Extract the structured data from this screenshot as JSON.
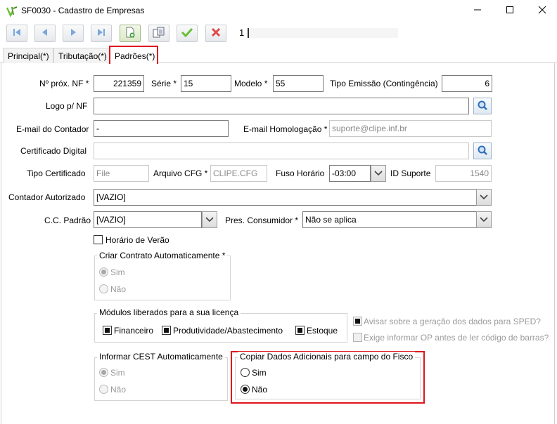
{
  "window": {
    "title": "SF0030 - Cadastro de Empresas",
    "minimize_icon": "minimize-icon",
    "maximize_icon": "maximize-icon",
    "close_icon": "close-icon"
  },
  "toolbar": {
    "buttons": [
      {
        "name": "first-record",
        "icon": "skip-first-icon"
      },
      {
        "name": "previous-record",
        "icon": "previous-icon"
      },
      {
        "name": "next-record",
        "icon": "next-icon"
      },
      {
        "name": "last-record",
        "icon": "skip-last-icon"
      },
      {
        "name": "new-record",
        "icon": "new-document-icon"
      },
      {
        "name": "copy-record",
        "icon": "copy-icon"
      },
      {
        "name": "confirm",
        "icon": "check-icon"
      },
      {
        "name": "cancel",
        "icon": "x-icon"
      }
    ],
    "record_number": "1"
  },
  "tabs": [
    {
      "label": "Principal(*)"
    },
    {
      "label": "Tributação(*)"
    },
    {
      "label": "Padrões(*)",
      "selected": true
    }
  ],
  "form": {
    "prox_nf": {
      "label": "Nº próx. NF *",
      "value": "221359"
    },
    "serie": {
      "label": "Série *",
      "value": "15"
    },
    "modelo": {
      "label": "Modelo *",
      "value": "55"
    },
    "tipo_emissao": {
      "label": "Tipo Emissão (Contingência)",
      "value": "6"
    },
    "logo_nf": {
      "label": "Logo p/ NF",
      "value": ""
    },
    "email_contador": {
      "label": "E-mail do Contador",
      "value": "-"
    },
    "email_homologacao": {
      "label": "E-mail Homologação *",
      "value": "suporte@clipe.inf.br"
    },
    "certificado_digital": {
      "label": "Certificado Digital",
      "value": ""
    },
    "tipo_certificado": {
      "label": "Tipo Certificado",
      "value": "File"
    },
    "arquivo_cfg": {
      "label": "Arquivo CFG *",
      "value": "CLIPE.CFG"
    },
    "fuso_horario": {
      "label": "Fuso Horário",
      "value": "-03:00"
    },
    "id_suporte": {
      "label": "ID Suporte",
      "value": "1540"
    },
    "contador_autorizado": {
      "label": "Contador Autorizado",
      "value": "[VAZIO]"
    },
    "cc_padrao": {
      "label": "C.C. Padrão",
      "value": "[VAZIO]"
    },
    "pres_consumidor": {
      "label": "Pres. Consumidor *",
      "value": "Não se aplica"
    },
    "horario_verao": {
      "label": "Horário de Verão",
      "checked": false
    }
  },
  "groups": {
    "criar_contrato": {
      "title": "Criar Contrato Automaticamente *",
      "options": [
        "Sim",
        "Não"
      ],
      "selected": "Sim"
    },
    "modulos": {
      "title": "Módulos liberados para a sua licença",
      "items": [
        {
          "label": "Financeiro",
          "checked": true
        },
        {
          "label": "Produtividade/Abastecimento",
          "checked": true
        },
        {
          "label": "Estoque",
          "checked": true
        }
      ]
    },
    "avisar_sped": {
      "label": "Avisar sobre a geração dos dados para SPED?",
      "checked": true
    },
    "exige_op": {
      "label": "Exige informar OP antes de ler código de barras?",
      "checked": false
    },
    "informar_cest": {
      "title": "Informar CEST Automaticamente",
      "options": [
        "Sim",
        "Não"
      ],
      "selected": "Sim"
    },
    "copiar_dados": {
      "title": "Copiar Dados Adicionais para campo do Fisco",
      "options": [
        "Sim",
        "Não"
      ],
      "selected": "Não"
    }
  },
  "colors": {
    "highlight": "#e0141c",
    "nav_blue": "#2e7cd6",
    "confirm_green": "#6abf3a",
    "cancel_red": "#e04848"
  }
}
